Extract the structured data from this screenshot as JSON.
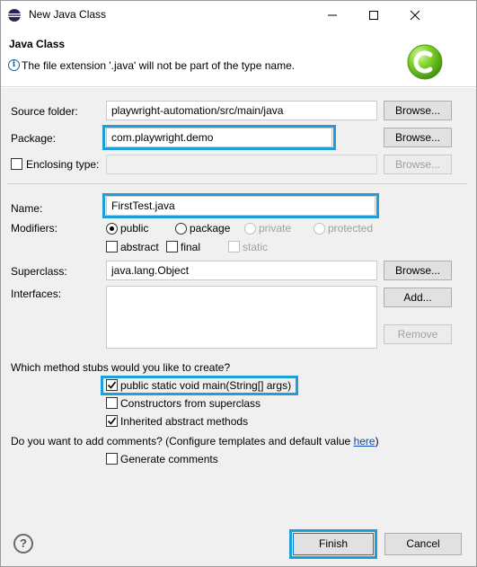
{
  "window": {
    "title": "New Java Class",
    "minimize": "—",
    "maximize": "☐",
    "close": "✕"
  },
  "banner": {
    "title": "Java Class",
    "info_icon": "i",
    "message": "The file extension '.java' will not be part of the type name."
  },
  "form": {
    "source_folder": {
      "label": "Source folder:",
      "value": "playwright-automation/src/main/java",
      "button": "Browse..."
    },
    "package": {
      "label": "Package:",
      "value": "com.playwright.demo",
      "button": "Browse..."
    },
    "enclosing_type": {
      "label": "Enclosing type:",
      "value": "",
      "button": "Browse...",
      "checked": false
    },
    "name": {
      "label": "Name:",
      "value": "FirstTest.java"
    },
    "modifiers": {
      "label": "Modifiers:",
      "public": "public",
      "package": "package",
      "private": "private",
      "protected": "protected",
      "abstract": "abstract",
      "final": "final",
      "static": "static",
      "selected": "public"
    },
    "superclass": {
      "label": "Superclass:",
      "value": "java.lang.Object",
      "button": "Browse..."
    },
    "interfaces": {
      "label": "Interfaces:",
      "add_button": "Add...",
      "remove_button": "Remove"
    }
  },
  "stubs": {
    "question": "Which method stubs would you like to create?",
    "main": {
      "label": "public static void main(String[] args)",
      "checked": true
    },
    "constructors": {
      "label": "Constructors from superclass",
      "checked": false
    },
    "inherited": {
      "label": "Inherited abstract methods",
      "checked": true
    }
  },
  "comments": {
    "question": "Do you want to add comments? (Configure templates and default value ",
    "link": "here",
    "question_end": ")",
    "generate": {
      "label": "Generate comments",
      "checked": false
    }
  },
  "footer": {
    "help_icon": "?",
    "finish": "Finish",
    "cancel": "Cancel"
  },
  "colors": {
    "highlight": "#1e9fd8",
    "link": "#0a4bb5",
    "logo_green": "#6cc21c"
  }
}
